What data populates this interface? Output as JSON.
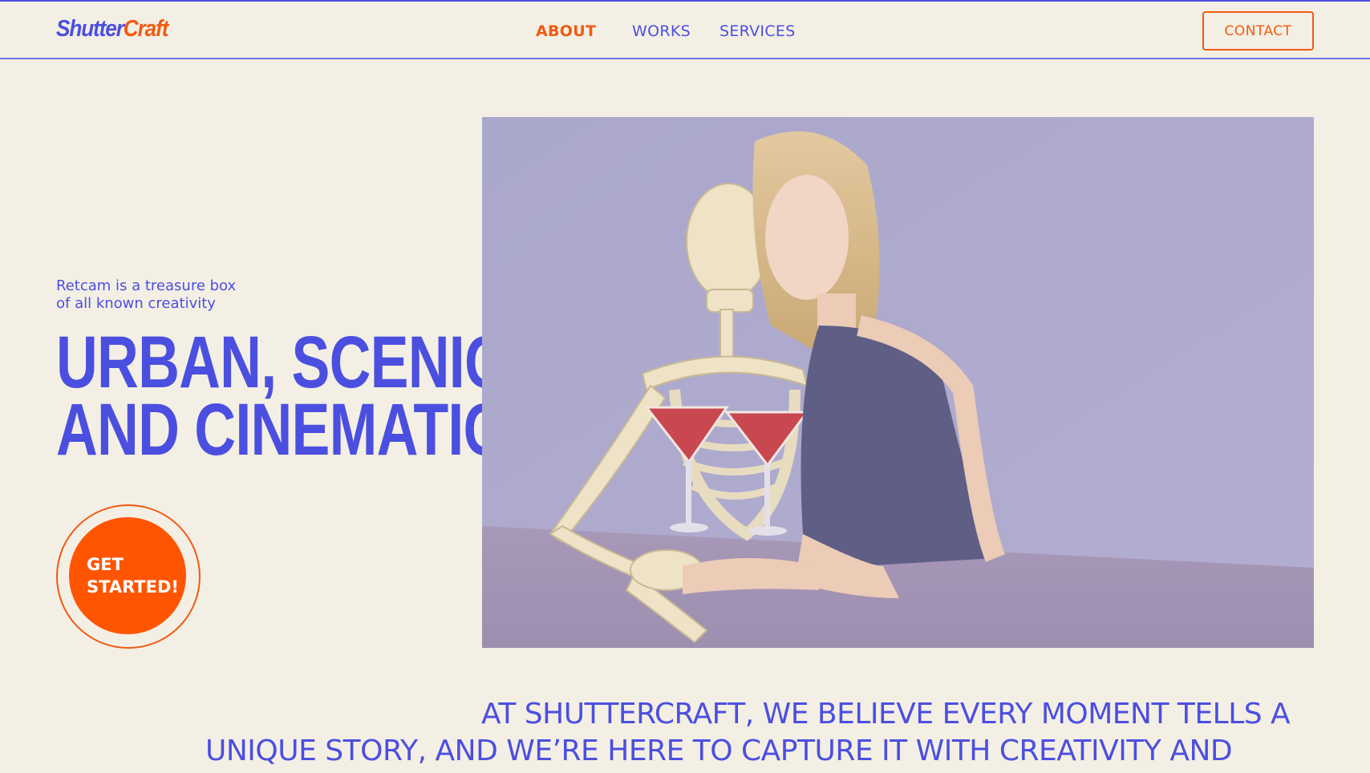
{
  "brand": {
    "logo_part1": "Shutter",
    "logo_part2": "Craft"
  },
  "nav": {
    "items": [
      "ABOUT",
      "WORKS",
      "SERVICES"
    ],
    "active": "ABOUT"
  },
  "header": {
    "contact_label": "CONTACT"
  },
  "hero": {
    "tagline_line1": "Retcam is a treasure box",
    "tagline_line2": "of all known creativity",
    "headline_line1": "URBAN, SCENIC",
    "headline_line2": "AND CINEMATIC",
    "cta_line1": "GET",
    "cta_line2": "STARTED!",
    "image_subject": "woman-with-skeleton-and-cocktails"
  },
  "statement": {
    "line1": "AT SHUTTERCRAFT, WE BELIEVE EVERY MOMENT TELLS A",
    "line2": "UNIQUE STORY, AND WE’RE HERE TO CAPTURE IT WITH CREATIVITY AND"
  },
  "colors": {
    "accent_blue": "#4b4fe0",
    "accent_orange": "#f05a12",
    "cta_fill": "#ff5500",
    "background": "#f4efe4"
  }
}
